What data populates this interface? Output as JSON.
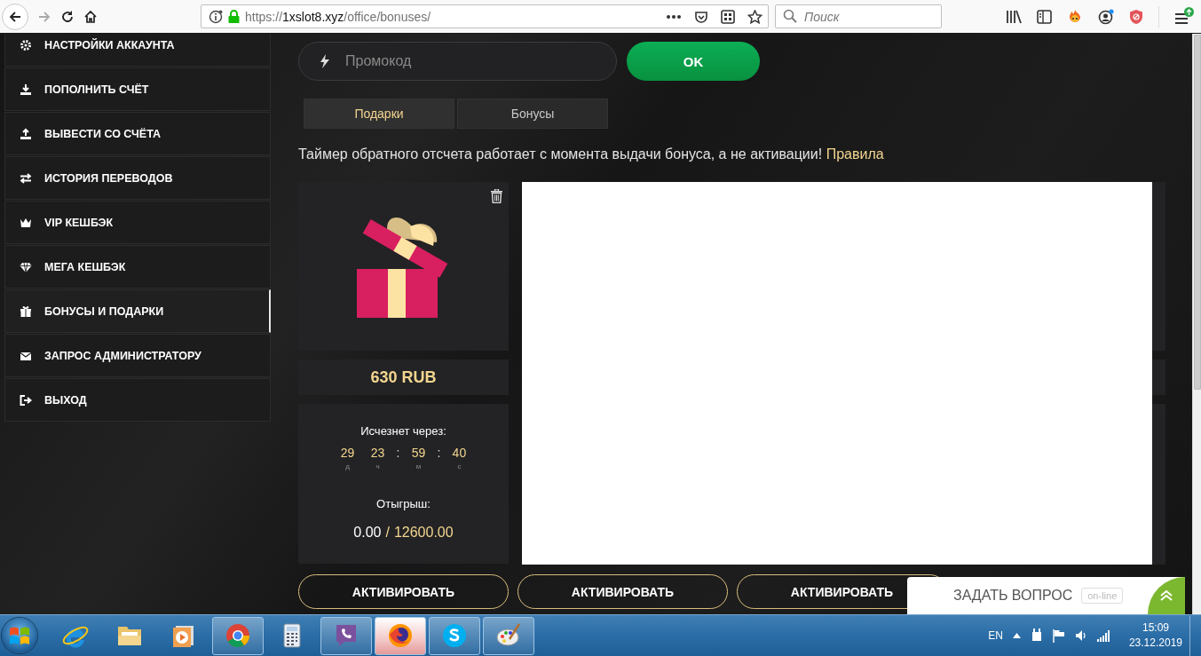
{
  "browser": {
    "url_scheme": "https://",
    "url_host": "1xslot8.xyz",
    "url_path": "/office/bonuses/",
    "search_placeholder": "Поиск"
  },
  "sidebar": {
    "items": [
      {
        "label": "НАСТРОЙКИ АККАУНТА",
        "selected": false
      },
      {
        "label": "ПОПОЛНИТЬ СЧЁТ",
        "selected": false
      },
      {
        "label": "ВЫВЕСТИ СО СЧЁТА",
        "selected": false
      },
      {
        "label": "ИСТОРИЯ ПЕРЕВОДОВ",
        "selected": false
      },
      {
        "label": "VIP КЕШБЭК",
        "selected": false
      },
      {
        "label": "МЕГА КЕШБЭК",
        "selected": false
      },
      {
        "label": "БОНУСЫ И ПОДАРКИ",
        "selected": true
      },
      {
        "label": "ЗАПРОС АДМИНИСТРАТОРУ",
        "selected": false
      },
      {
        "label": "ВЫХОД",
        "selected": false
      }
    ]
  },
  "promo": {
    "placeholder": "Промокод",
    "button": "OK"
  },
  "tabs": [
    {
      "label": "Подарки",
      "selected": true
    },
    {
      "label": "Бонусы",
      "selected": false
    }
  ],
  "notice": {
    "text": "Таймер обратного отсчета работает с момента выдачи бонуса, а не активации!",
    "link": "Правила"
  },
  "bonus_card": {
    "amount": "630 RUB",
    "expires_label": "Исчезнет через:",
    "countdown": [
      {
        "value": "29",
        "unit": "д"
      },
      {
        "value": "23",
        "unit": "ч",
        "separator_after": ":"
      },
      {
        "value": "59",
        "unit": "м",
        "separator_after": ":"
      },
      {
        "value": "40",
        "unit": "с"
      }
    ],
    "wager_label": "Отыгрыш:",
    "wager_done": "0.00",
    "wager_separator": "/",
    "wager_total": "12600.00"
  },
  "activate_buttons": [
    "АКТИВИРОВАТЬ",
    "АКТИВИРОВАТЬ",
    "АКТИВИРОВАТЬ"
  ],
  "chat_widget": {
    "label": "ЗАДАТЬ ВОПРОС",
    "status": "on-line"
  },
  "taskbar": {
    "apps": [
      {
        "running": false,
        "active": false
      },
      {
        "running": false,
        "active": false
      },
      {
        "running": false,
        "active": false
      },
      {
        "running": true,
        "active": false
      },
      {
        "running": false,
        "active": false
      },
      {
        "running": true,
        "active": false
      },
      {
        "running": true,
        "active": true
      },
      {
        "running": true,
        "active": false
      },
      {
        "running": true,
        "active": false
      }
    ],
    "language": "EN",
    "time": "15:09",
    "date": "23.12.2019"
  }
}
